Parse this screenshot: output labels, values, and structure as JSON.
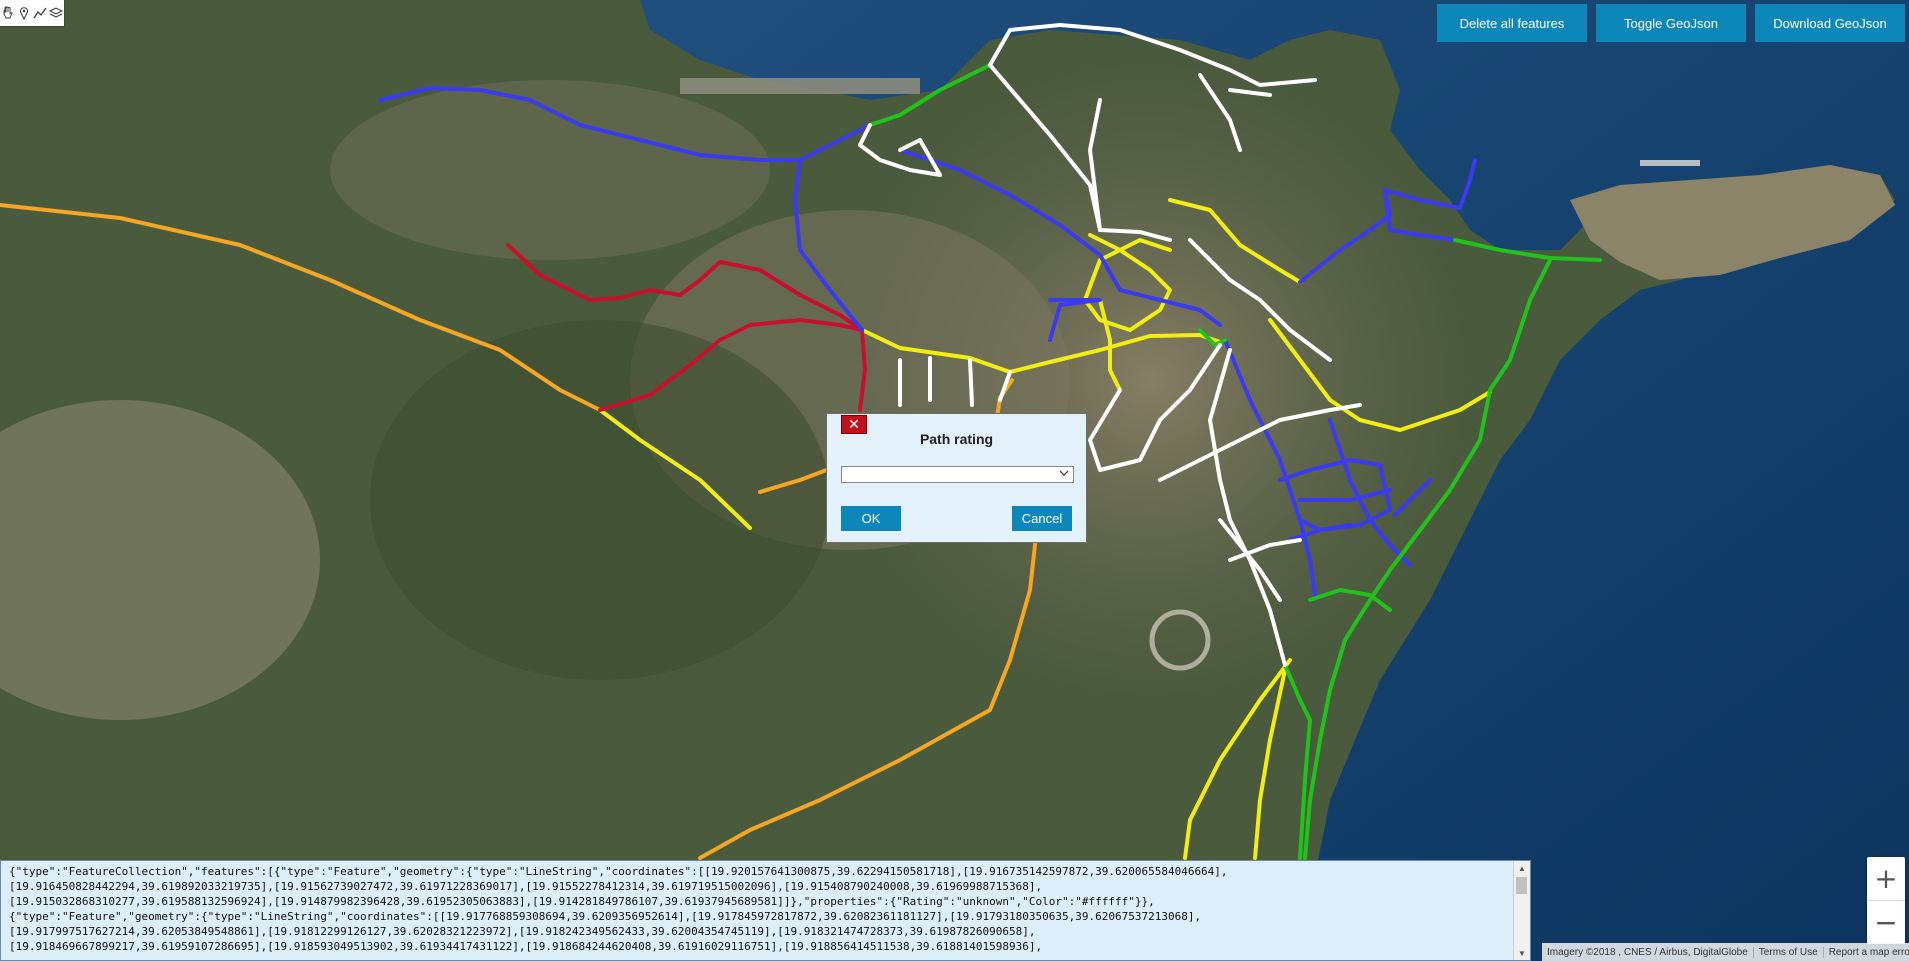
{
  "toolbar": {
    "tools": [
      "hand-icon",
      "marker-icon",
      "polyline-icon",
      "layers-icon"
    ]
  },
  "top_buttons": {
    "delete_all": "Delete all features",
    "toggle_geojson": "Toggle GeoJson",
    "download_geojson": "Download GeoJson"
  },
  "dialog": {
    "close_label": "✕",
    "title": "Path rating",
    "select_value": "",
    "ok": "OK",
    "cancel": "Cancel"
  },
  "zoom": {
    "in": "+",
    "out": "−"
  },
  "attribution": {
    "imagery": "Imagery ©2018 , CNES / Airbus, DigitalGlobe",
    "terms": "Terms of Use",
    "report": "Report a map error"
  },
  "geojson_text": "{\"type\":\"FeatureCollection\",\"features\":[{\"type\":\"Feature\",\"geometry\":{\"type\":\"LineString\",\"coordinates\":[[19.920157641300875,39.62294150581718],[19.916735142597872,39.620065584046664],\n[19.916450828442294,39.619892033219735],[19.91562739027472,39.61971228369017],[19.91552278412314,39.619719515002096],[19.915408790240008,39.61969988715368],\n[19.915032868310277,39.619588132596924],[19.914879982396428,39.61952305063883],[19.914281849786107,39.61937945689581]]},\"properties\":{\"Rating\":\"unknown\",\"Color\":\"#ffffff\"}},\n{\"type\":\"Feature\",\"geometry\":{\"type\":\"LineString\",\"coordinates\":[[19.917768859308694,39.6209356952614],[19.917845972817872,39.62082361181127],[19.91793180350635,39.62067537213068],\n[19.917997517627214,39.62053849548861],[19.91812299126127,39.62028321223972],[19.918242349562433,39.62004354745119],[19.918321474728373,39.61987826090658],\n[19.918469667899217,39.61959107286695],[19.918593049513902,39.61934417431122],[19.918684244620408,39.61916029116751],[19.918856414511538,39.61881401598936],",
  "map_colors": {
    "white": "#ffffff",
    "blue": "#3a3af0",
    "green": "#22c21c",
    "yellow": "#f2ee12",
    "red": "#c8102e",
    "orange": "#f5a623",
    "sea": "#123d6a"
  }
}
